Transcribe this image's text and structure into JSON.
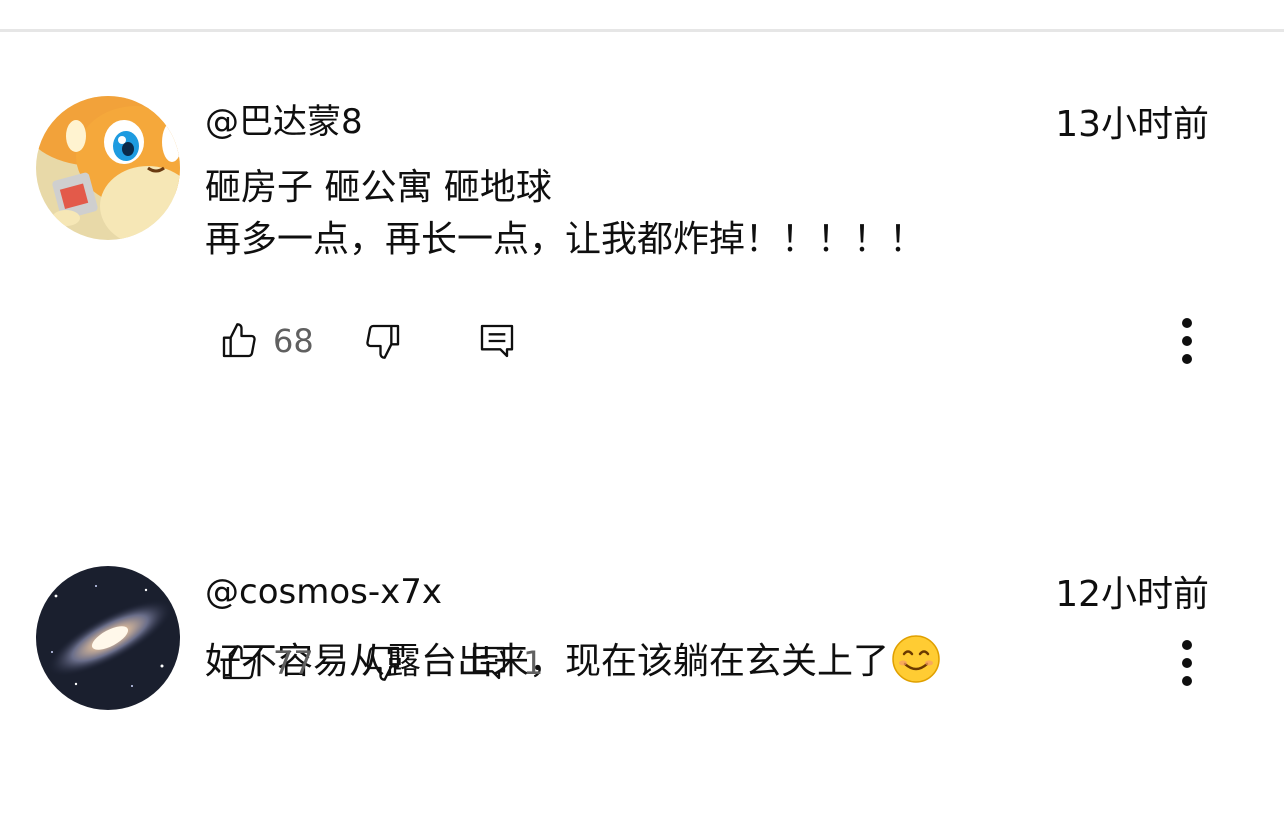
{
  "comments": [
    {
      "author": "@巴达蒙8",
      "time": "13小时前",
      "lines": [
        "砸房子 砸公寓 砸地球",
        "再多一点，再长一点，让我都炸掉！！！！！"
      ],
      "likes": "68",
      "replies": "",
      "avatar": "orange-hamster-cartoon"
    },
    {
      "author": "@cosmos-x7x",
      "time": "12小时前",
      "lines": [
        "好不容易从露台出来，现在该躺在玄关上了"
      ],
      "likes": "77",
      "replies": "1",
      "avatar": "galaxy-photo"
    }
  ],
  "icons": {
    "like": "thumbs-up-icon",
    "dislike": "thumbs-down-icon",
    "reply": "reply-comment-icon",
    "more": "more-vertical-icon",
    "emoji": "smiling-face-emoji"
  },
  "colors": {
    "text": "#0f0f0f",
    "secondary": "#606060",
    "divider": "#e6e6e6"
  }
}
